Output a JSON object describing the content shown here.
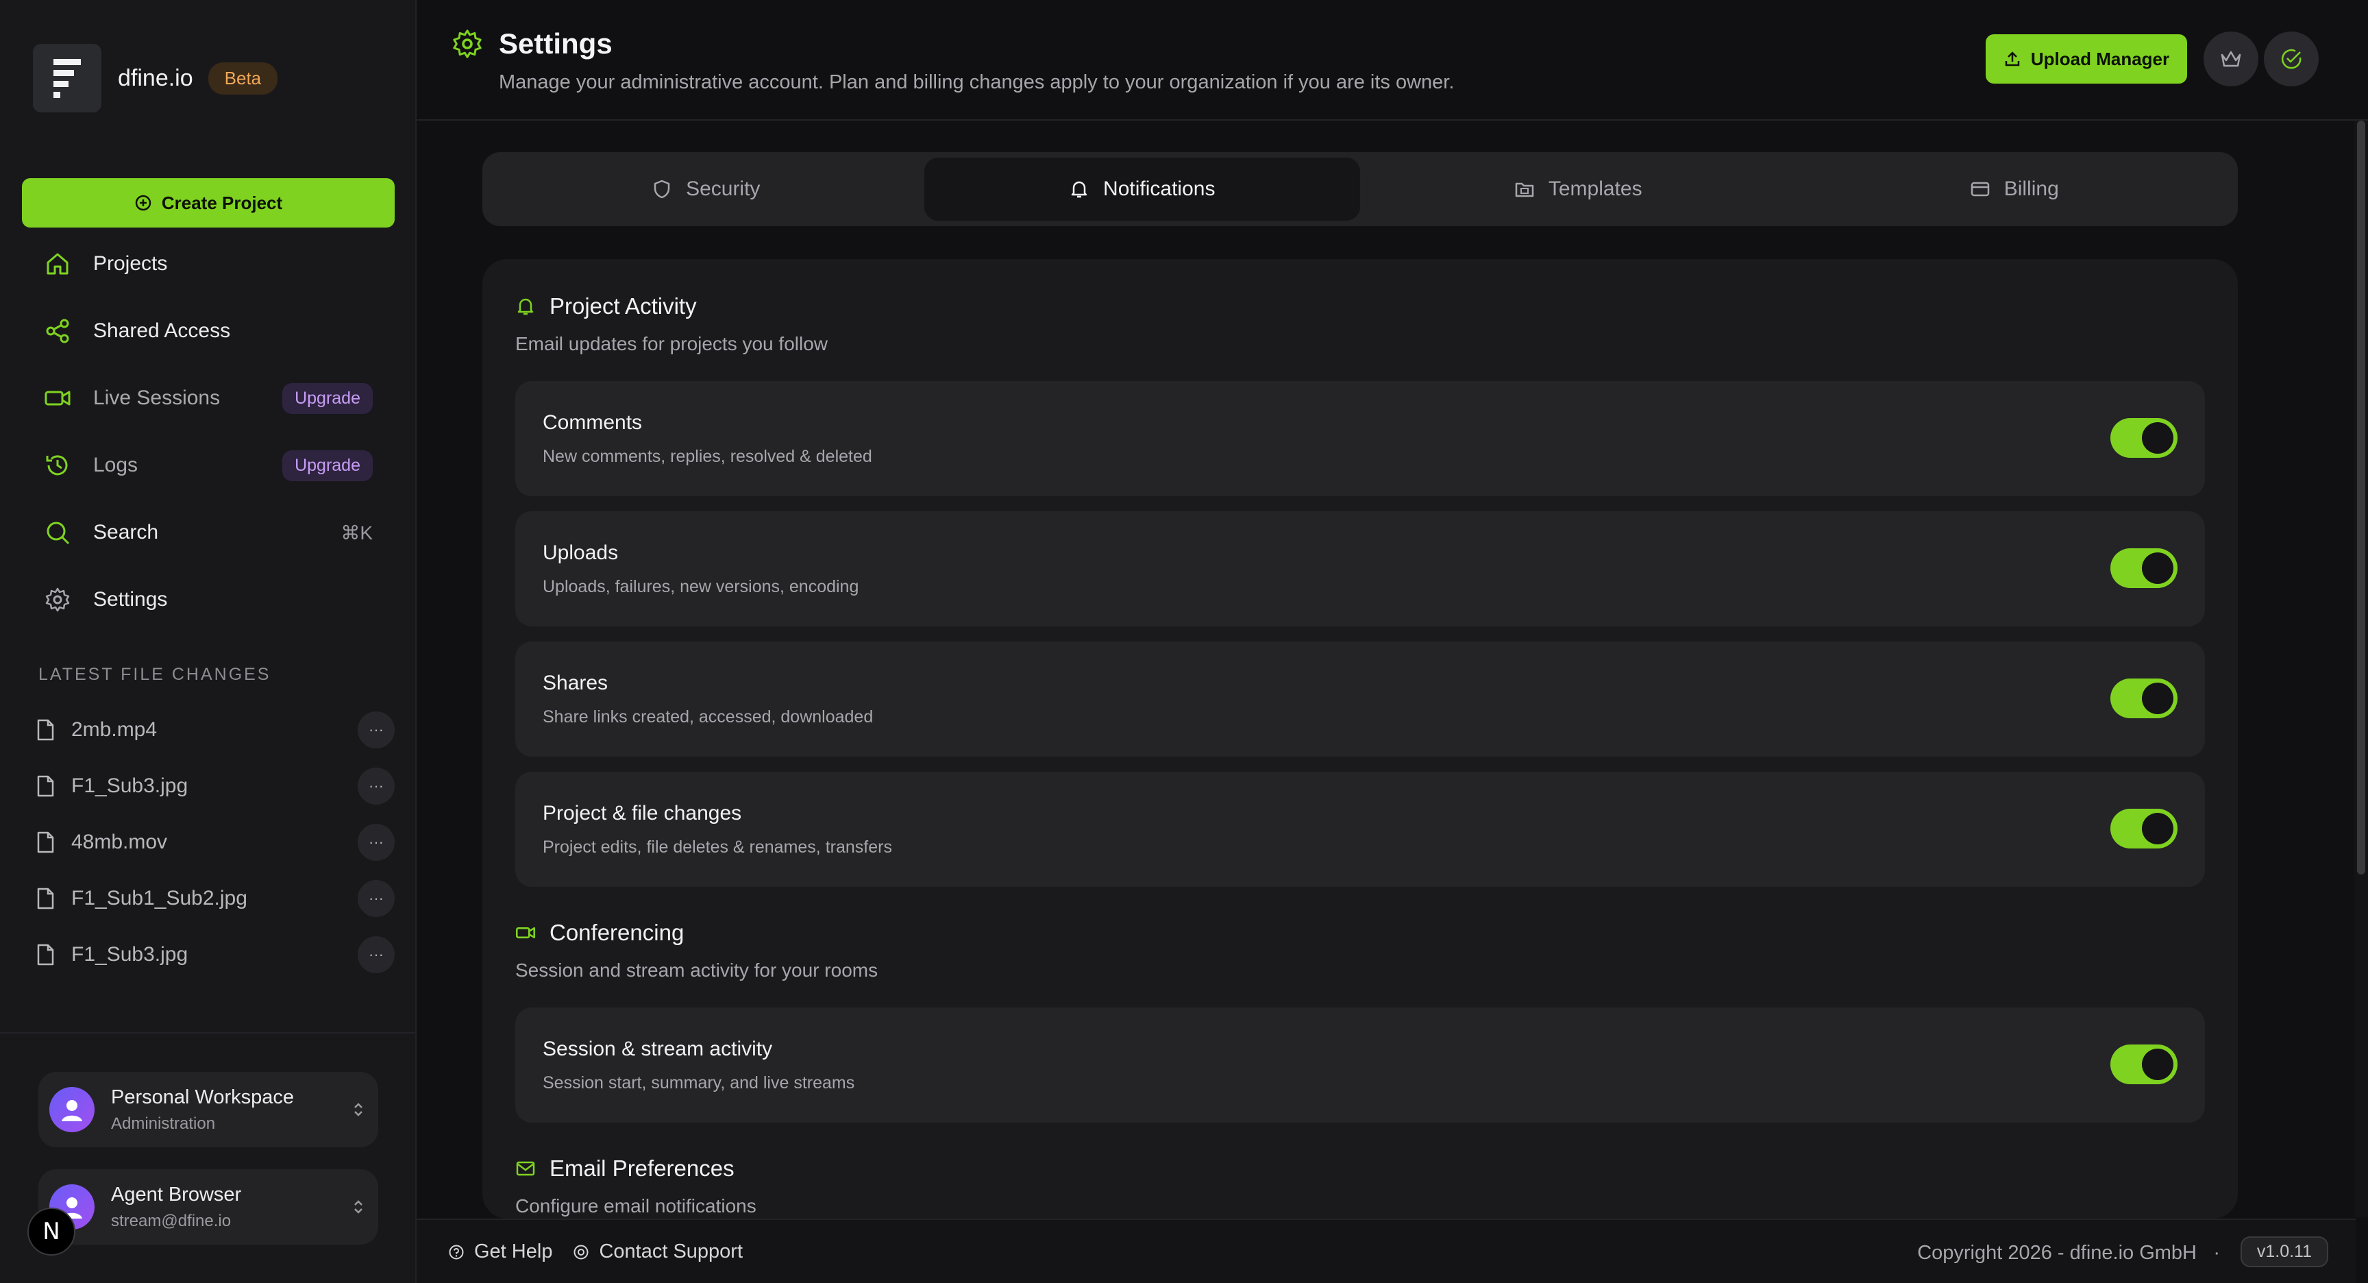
{
  "brand": {
    "name": "dfine.io",
    "badge": "Beta"
  },
  "sidebar": {
    "create_label": "Create Project",
    "items": [
      {
        "label": "Projects",
        "icon": "home-icon"
      },
      {
        "label": "Shared Access",
        "icon": "share-icon"
      },
      {
        "label": "Live Sessions",
        "icon": "video-icon",
        "badge": "Upgrade"
      },
      {
        "label": "Logs",
        "icon": "history-icon",
        "badge": "Upgrade"
      },
      {
        "label": "Search",
        "icon": "search-icon",
        "shortcut": "⌘K"
      },
      {
        "label": "Settings",
        "icon": "gear-icon"
      }
    ],
    "files_heading": "LATEST FILE CHANGES",
    "files": [
      "2mb.mp4",
      "F1_Sub3.jpg",
      "48mb.mov",
      "F1_Sub1_Sub2.jpg",
      "F1_Sub3.jpg"
    ],
    "more_label": "···",
    "workspace": {
      "title": "Personal Workspace",
      "subtitle": "Administration"
    },
    "user": {
      "name": "Agent Browser",
      "email": "stream@dfine.io"
    },
    "n_badge": "N"
  },
  "header": {
    "title": "Settings",
    "description": "Manage your administrative account. Plan and billing changes apply to your organization if you are its owner.",
    "upload_label": "Upload Manager"
  },
  "tabs": [
    {
      "label": "Security",
      "icon": "shield-icon",
      "active": false
    },
    {
      "label": "Notifications",
      "icon": "bell-icon",
      "active": true
    },
    {
      "label": "Templates",
      "icon": "folder-icon",
      "active": false
    },
    {
      "label": "Billing",
      "icon": "card-icon",
      "active": false
    }
  ],
  "groups": {
    "activity": {
      "title": "Project Activity",
      "subtitle": "Email updates for projects you follow",
      "rows": [
        {
          "title": "Comments",
          "desc": "New comments, replies, resolved & deleted",
          "on": true
        },
        {
          "title": "Uploads",
          "desc": "Uploads, failures, new versions, encoding",
          "on": true
        },
        {
          "title": "Shares",
          "desc": "Share links created, accessed, downloaded",
          "on": true
        },
        {
          "title": "Project & file changes",
          "desc": "Project edits, file deletes & renames, transfers",
          "on": true
        }
      ]
    },
    "conferencing": {
      "title": "Conferencing",
      "subtitle": "Session and stream activity for your rooms",
      "rows": [
        {
          "title": "Session & stream activity",
          "desc": "Session start, summary, and live streams",
          "on": true
        }
      ]
    },
    "email": {
      "title": "Email Preferences",
      "subtitle": "Configure email notifications"
    }
  },
  "footer": {
    "help": "Get Help",
    "support": "Contact Support",
    "copyright": "Copyright 2026 - dfine.io GmbH",
    "separator": "·",
    "version": "v1.0.11"
  },
  "colors": {
    "accent": "#7fd320",
    "background": "#101012",
    "panel": "#1a1a1d",
    "upgrade": "#c79cf4",
    "beta": "#f0a85a"
  }
}
